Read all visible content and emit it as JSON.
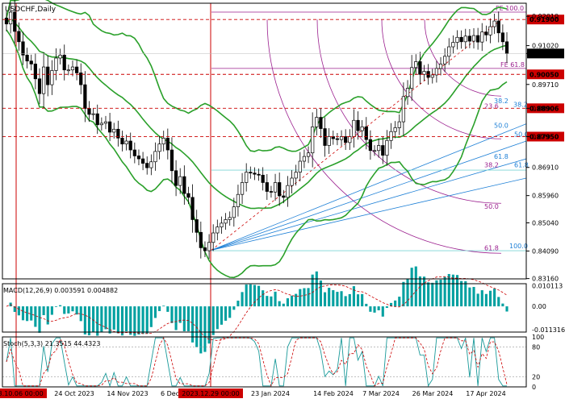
{
  "chart_data": {
    "type": "candlestick",
    "title": "USDCHF,Daily",
    "y_range": [
      0.8315,
      0.9245
    ],
    "y_ticks": [
      "0.92010",
      "0.91020",
      "0.90754",
      "0.89710",
      "0.88906",
      "0.87950",
      "0.86910",
      "0.85960",
      "0.85040",
      "0.84090",
      "0.83160"
    ],
    "price_labels": [
      {
        "value": 0.919,
        "text": "0.91900",
        "color": "#cc0000"
      },
      {
        "value": 0.90754,
        "text": "0.90754",
        "color": "#000000"
      },
      {
        "value": 0.9005,
        "text": "0.90050",
        "color": "#cc0000"
      },
      {
        "value": 0.88906,
        "text": "0.88906",
        "color": "#cc0000"
      },
      {
        "value": 0.8795,
        "text": "0.87950",
        "color": "#cc0000"
      }
    ],
    "x_labels": [
      "2023.10.06 00:00",
      "24 Oct 2023",
      "14 Nov 2023",
      "6 Dec 2023",
      "2023.12.29 00:00",
      "23 Jan 2024",
      "14 Feb 2024",
      "7 Mar 2024",
      "26 Mar 2024",
      "17 Apr 2024"
    ],
    "marker_labels": [
      "2023.10.06 00:00",
      "2023.12.29 00:00"
    ],
    "close_path": [
      0.9175,
      0.9215,
      0.915,
      0.9115,
      0.907,
      0.905,
      0.904,
      0.899,
      0.894,
      0.903,
      0.897,
      0.9018,
      0.906,
      0.907,
      0.902,
      0.902,
      0.903,
      0.901,
      0.897,
      0.889,
      0.887,
      0.8872,
      0.8835,
      0.884,
      0.8845,
      0.881,
      0.882,
      0.879,
      0.877,
      0.878,
      0.875,
      0.873,
      0.872,
      0.8705,
      0.869,
      0.871,
      0.8745,
      0.877,
      0.879,
      0.875,
      0.868,
      0.863,
      0.866,
      0.8603,
      0.859,
      0.8515,
      0.8472,
      0.842,
      0.841,
      0.8438,
      0.847,
      0.849,
      0.8503,
      0.8515,
      0.8522,
      0.8558,
      0.86,
      0.864,
      0.8675,
      0.8672,
      0.8668,
      0.8665,
      0.864,
      0.861,
      0.8608,
      0.864,
      0.8595,
      0.859,
      0.863,
      0.8655,
      0.8675,
      0.8712,
      0.8728,
      0.874,
      0.8828,
      0.886,
      0.8822,
      0.8765,
      0.8795,
      0.8788,
      0.8785,
      0.8795,
      0.8775,
      0.8795,
      0.885,
      0.8815,
      0.8828,
      0.8785,
      0.8748,
      0.8748,
      0.8765,
      0.8732,
      0.8782,
      0.8812,
      0.8825,
      0.8845,
      0.893,
      0.8958,
      0.9028,
      0.9048,
      0.9005,
      0.9015,
      0.8995,
      0.9003,
      0.9025,
      0.904,
      0.9066,
      0.9098,
      0.9113,
      0.913,
      0.9115,
      0.9134,
      0.9117,
      0.9136,
      0.9114,
      0.9148,
      0.9138,
      0.9166,
      0.9185,
      0.9145,
      0.9115,
      0.9075
    ],
    "indicators": {
      "macd": {
        "label": "MACD(12,26,9) 0.003591 0.004882",
        "ticks": [
          "0.010113",
          "0.00",
          "-0.011316"
        ]
      },
      "stoch": {
        "label": "Stoch(5,3,3) 21.3515 44.4323",
        "ticks": [
          "100",
          "80",
          "20",
          "0"
        ]
      }
    },
    "fibonacci": {
      "fe": [
        "FE 100.0",
        "FE 61.8"
      ],
      "fibo_arcs": [
        "38.2",
        "50.0",
        "61.8"
      ],
      "fibo_fan_magenta": [
        "38.2",
        "23.6"
      ],
      "fibo_fan_blue": [
        "38.2",
        "50.0",
        "61.8",
        "100.0"
      ],
      "ext_labels": [
        "23.6",
        "50.0",
        "38.2",
        "61.8",
        "100.0"
      ]
    },
    "colors": {
      "up": "#000000",
      "down": "#000000",
      "bollinger": "#2aa02a",
      "fibo_magenta": "#9b1f8e",
      "fibo_blue": "#1c7fd6",
      "level_red": "#cc0000",
      "macd_hist": "#00a0a0",
      "signal": "#cc0000"
    }
  }
}
